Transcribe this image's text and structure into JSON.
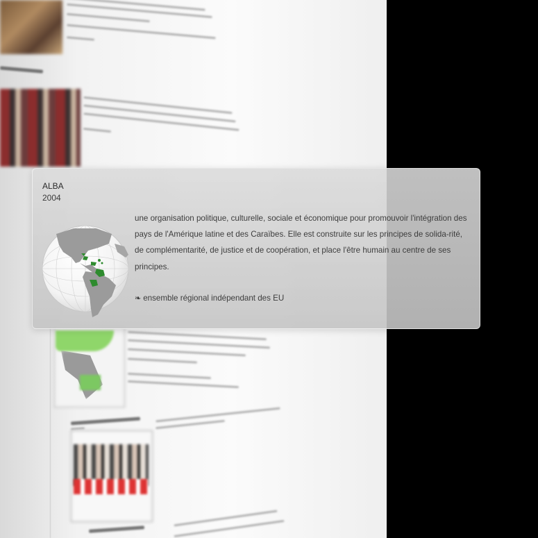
{
  "popup": {
    "name": "ALBA",
    "year": "2004",
    "description": "une organisation politique, culturelle, sociale et économique pour promouvoir l'intégration des pays de l'Amérique latine et des Caraïbes. Elle est construite sur les principes de solida-rité, de complémentarité, de justice et de coopération, et place l'être humain au centre de ses principes.",
    "note_icon": "❧",
    "note": "ensemble régional indépendant des EU",
    "globe_icon": "globe-map-icon",
    "colors": {
      "member_green": "#2e8b2e",
      "card_bg": "#d4d4d4"
    }
  },
  "background": {
    "colors": {
      "page": "#f4f4f4",
      "surround": "#000000",
      "map_green": "#8fd66a"
    }
  }
}
